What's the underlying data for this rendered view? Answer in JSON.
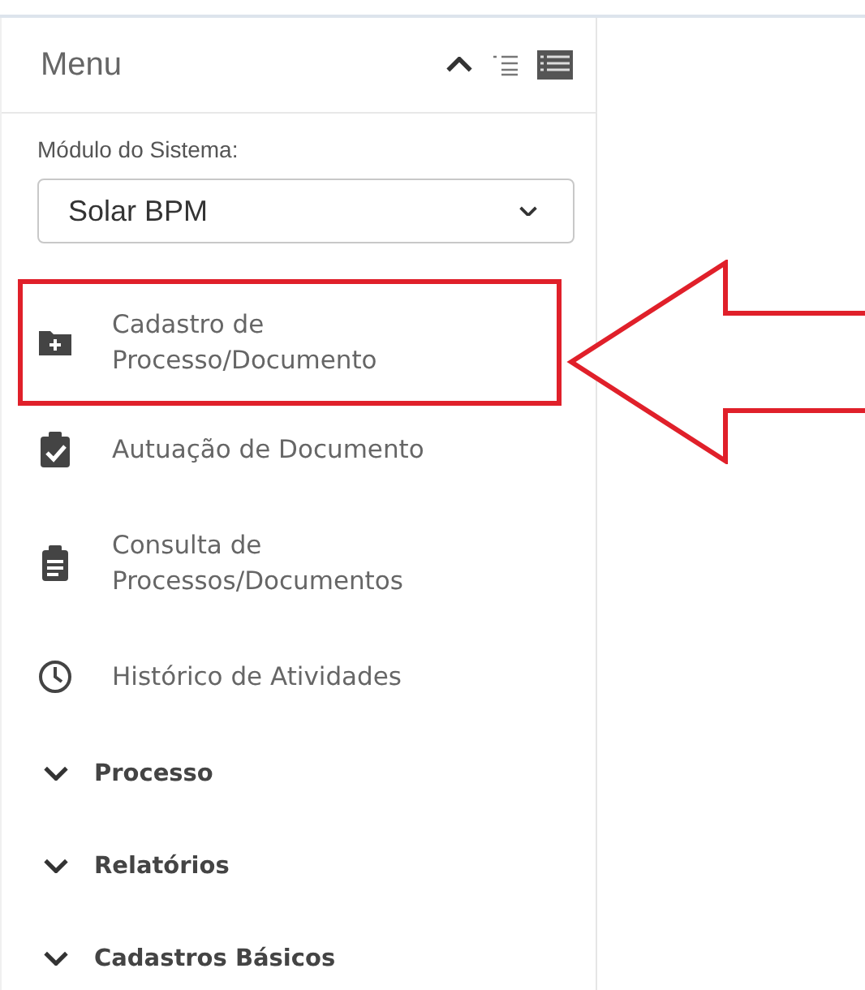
{
  "sidebar": {
    "title": "Menu",
    "module_field": {
      "label": "Módulo do Sistema:",
      "value": "Solar BPM"
    },
    "items": [
      {
        "kind": "link",
        "label": "Cadastro de\nProcesso/Documento",
        "highlighted": true
      },
      {
        "kind": "link",
        "label": "Autuação de Documento",
        "highlighted": false
      },
      {
        "kind": "link",
        "label": "Consulta de\nProcessos/Documentos",
        "highlighted": false
      },
      {
        "kind": "link",
        "label": "Histórico de Atividades",
        "highlighted": false
      },
      {
        "kind": "group",
        "label": "Processo",
        "expanded": false
      },
      {
        "kind": "group",
        "label": "Relatórios",
        "expanded": false
      },
      {
        "kind": "group",
        "label": "Cadastros Básicos",
        "expanded": false
      }
    ]
  }
}
